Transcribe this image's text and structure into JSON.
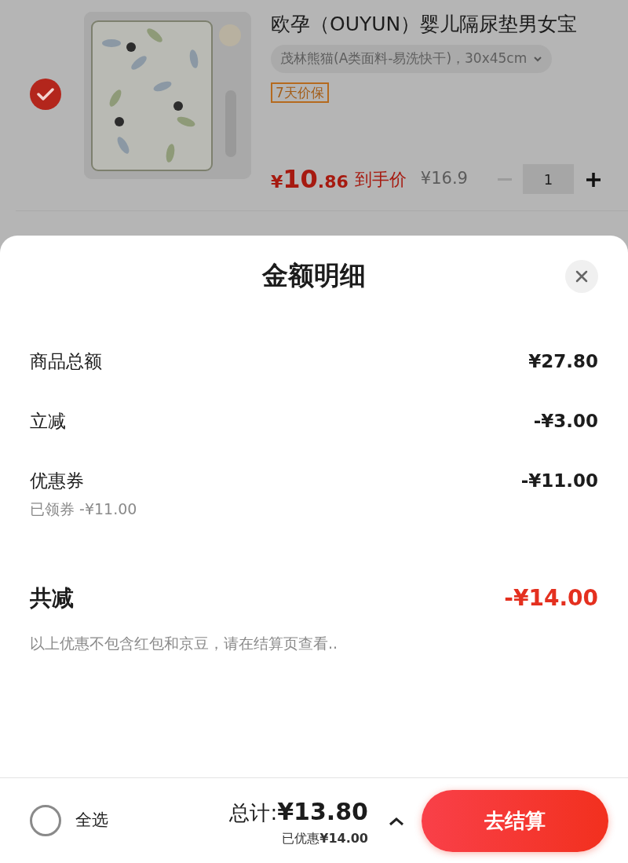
{
  "product": {
    "selected": true,
    "title": "欧孕（OUYUN）婴儿隔尿垫男女宝",
    "spec": "茂林熊猫(A类面料-易洗快干)，30x45cm",
    "tag": "7天价保",
    "price_symbol": "¥",
    "price_int": "10",
    "price_dec": ".86",
    "price_label": "到手价",
    "original_price": "¥16.9",
    "quantity": "1"
  },
  "sheet": {
    "title": "金额明细",
    "rows": [
      {
        "label": "商品总额",
        "value": "¥27.80"
      },
      {
        "label": "立减",
        "value": "-¥3.00"
      },
      {
        "label": "优惠券",
        "value": "-¥11.00",
        "note": "已领券 -¥11.00"
      }
    ],
    "total": {
      "label": "共减",
      "value": "-¥14.00"
    },
    "disclaimer": "以上优惠不包含红包和京豆，请在结算页查看.."
  },
  "bottom_bar": {
    "select_all": {
      "label": "全选",
      "checked": false
    },
    "total_label": "总计:",
    "total_value": "¥13.80",
    "saved": "已优惠**¥14.00**",
    "checkout": "去结算"
  }
}
